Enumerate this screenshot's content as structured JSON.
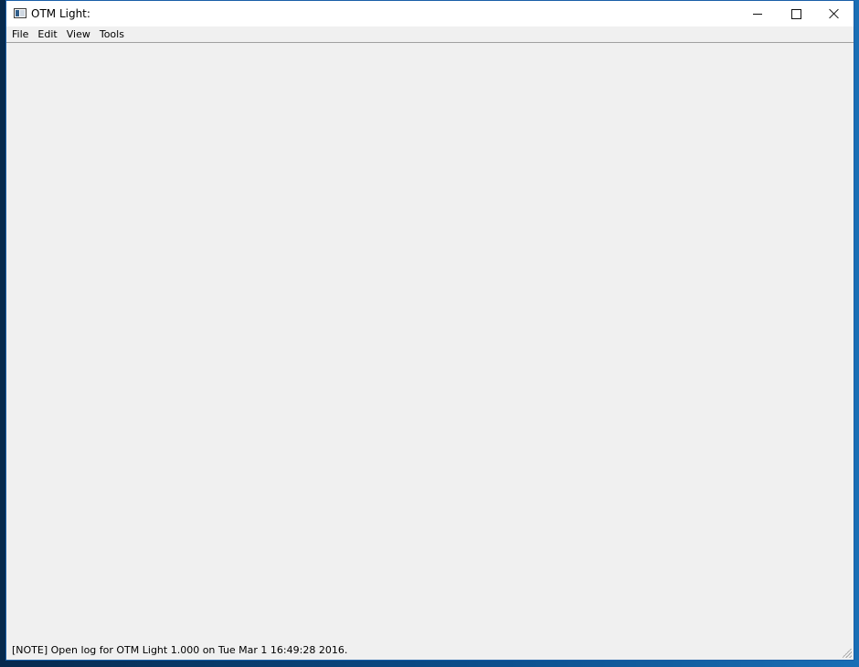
{
  "window": {
    "title": "OTM Light:"
  },
  "menubar": {
    "items": [
      {
        "label": "File"
      },
      {
        "label": "Edit"
      },
      {
        "label": "View"
      },
      {
        "label": "Tools"
      }
    ]
  },
  "statusbar": {
    "text": "[NOTE] Open log for OTM Light 1.000 on Tue Mar 1 16:49:28 2016."
  },
  "icons": {
    "app": "app-window-icon",
    "minimize": "minimize-icon",
    "maximize": "maximize-icon",
    "close": "close-icon",
    "resize": "resize-grip-icon"
  },
  "colors": {
    "window_background": "#f0f0f0",
    "titlebar_background": "#ffffff",
    "window_border": "#1a5fa8"
  }
}
